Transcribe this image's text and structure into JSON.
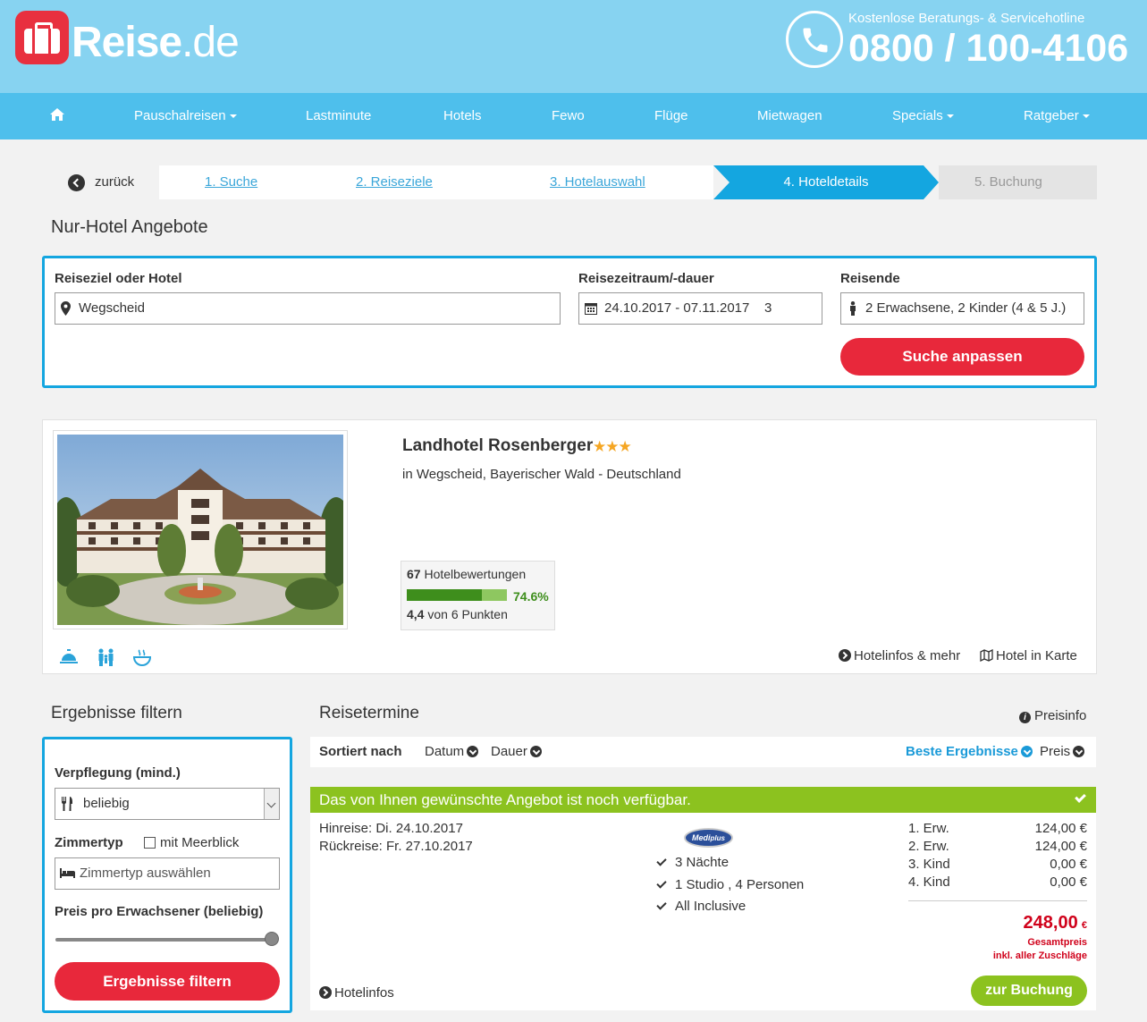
{
  "header": {
    "logo_main": "Reise",
    "logo_suffix": ".de",
    "hotline_label": "Kostenlose Beratungs- & Servicehotline",
    "hotline_number": "0800 / 100-4106"
  },
  "nav": {
    "items": [
      {
        "label": "Pauschalreisen",
        "dropdown": true
      },
      {
        "label": "Lastminute",
        "dropdown": false
      },
      {
        "label": "Hotels",
        "dropdown": false
      },
      {
        "label": "Fewo",
        "dropdown": false
      },
      {
        "label": "Flüge",
        "dropdown": false
      },
      {
        "label": "Mietwagen",
        "dropdown": false
      },
      {
        "label": "Specials",
        "dropdown": true
      },
      {
        "label": "Ratgeber",
        "dropdown": true
      }
    ]
  },
  "steps": {
    "back": "zurück",
    "items": [
      "1. Suche",
      "2. Reiseziele",
      "3. Hotelauswahl",
      "4. Hoteldetails",
      "5. Buchung"
    ],
    "active_index": 3
  },
  "page_title": "Nur-Hotel Angebote",
  "search": {
    "destination_label": "Reiseziel oder Hotel",
    "destination_value": "Wegscheid",
    "period_label": "Reisezeitraum/-dauer",
    "period_dates": "24.10.2017 - 07.11.2017",
    "period_duration": "3",
    "travelers_label": "Reisende",
    "travelers_value": "2 Erwachsene, 2 Kinder (4 & 5 J.)",
    "submit_label": "Suche anpassen"
  },
  "hotel": {
    "name": "Landhotel Rosenberger",
    "stars": "★★★",
    "star_count": 3,
    "location": "in Wegscheid, Bayerischer Wald - Deutschland",
    "review_count": "67",
    "review_label": "Hotelbewertungen",
    "rating_percent": "74.6%",
    "rating_fraction": 0.746,
    "score": "4,4",
    "score_suffix": "von 6 Punkten",
    "link_infos": "Hotelinfos & mehr",
    "link_map": "Hotel in Karte"
  },
  "filter": {
    "title": "Ergebnisse filtern",
    "board_label": "Verpflegung (mind.)",
    "board_value": "beliebig",
    "room_label": "Zimmertyp",
    "seaview_label": "mit Meerblick",
    "room_placeholder": "Zimmertyp auswählen",
    "price_label": "Preis pro Erwachsener (beliebig)",
    "price_slider_level": 1.0,
    "submit_label": "Ergebnisse filtern"
  },
  "results": {
    "title": "Reisetermine",
    "price_info": "Preisinfo",
    "sort_label": "Sortiert nach",
    "sort_date": "Datum",
    "sort_duration": "Dauer",
    "sort_best": "Beste Ergebnisse",
    "sort_price": "Preis",
    "availability": "Das von Ihnen gewünschte Angebot ist noch verfügbar.",
    "outbound": "Hinreise: Di. 24.10.2017",
    "return": "Rückreise: Fr. 27.10.2017",
    "operator_logo": "Meditplus",
    "features": [
      "3 Nächte",
      "1 Studio , 4 Personen",
      "All Inclusive"
    ],
    "prices": [
      {
        "label": "1. Erw.",
        "value": "124,00 €"
      },
      {
        "label": "2. Erw.",
        "value": "124,00 €"
      },
      {
        "label": "3. Kind",
        "value": "0,00 €"
      },
      {
        "label": "4. Kind",
        "value": "0,00 €"
      }
    ],
    "total": "248,00",
    "total_currency": "€",
    "total_label": "Gesamtpreis",
    "total_note": "inkl. aller Zuschläge",
    "hotelinfos": "Hotelinfos",
    "book_label": "zur Buchung"
  }
}
